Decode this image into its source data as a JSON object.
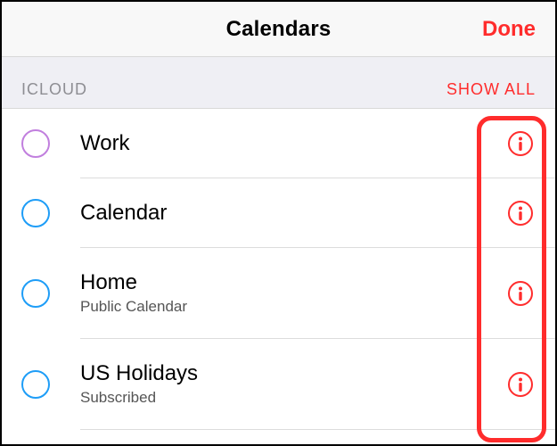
{
  "navbar": {
    "title": "Calendars",
    "done_label": "Done"
  },
  "section": {
    "label": "ICLOUD",
    "action_label": "SHOW ALL"
  },
  "calendars": [
    {
      "name": "Work",
      "subtitle": "",
      "color": "purple"
    },
    {
      "name": "Calendar",
      "subtitle": "",
      "color": "blue"
    },
    {
      "name": "Home",
      "subtitle": "Public Calendar",
      "color": "blue"
    },
    {
      "name": "US Holidays",
      "subtitle": "Subscribed",
      "color": "blue"
    }
  ],
  "colors": {
    "accent": "#ff2c2c"
  }
}
